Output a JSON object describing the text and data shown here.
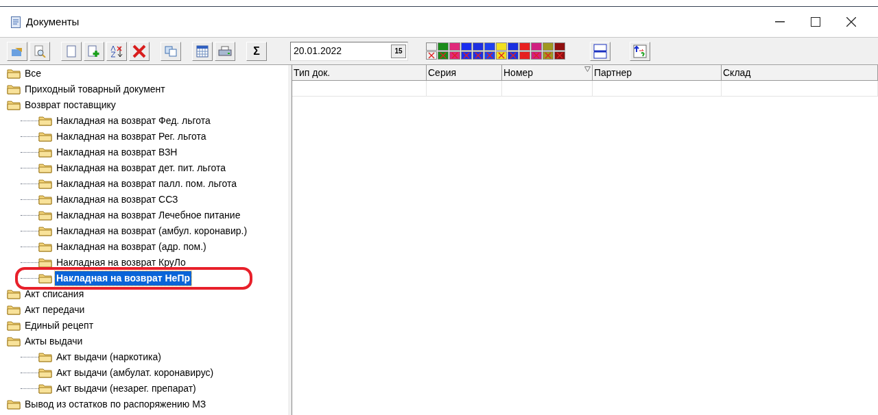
{
  "window": {
    "title": "Документы"
  },
  "filter": {
    "date": "20.01.2022",
    "calendar_label": "15"
  },
  "toolbar": {
    "sum_label": "Σ"
  },
  "tree": [
    {
      "label": "Все",
      "selected": false
    },
    {
      "label": "Приходный товарный документ",
      "selected": false
    },
    {
      "label": "Возврат поставщику",
      "selected": false,
      "children": [
        {
          "label": "Накладная на возврат Фед. льгота",
          "selected": false
        },
        {
          "label": "Накладная на возврат Рег. льгота",
          "selected": false
        },
        {
          "label": "Накладная на возврат ВЗН",
          "selected": false
        },
        {
          "label": "Накладная на возврат дет. пит. льгота",
          "selected": false
        },
        {
          "label": "Накладная на возврат палл. пом. льгота",
          "selected": false
        },
        {
          "label": "Накладная на возврат ССЗ",
          "selected": false
        },
        {
          "label": "Накладная на возврат Лечебное питание",
          "selected": false
        },
        {
          "label": "Накладная на возврат (амбул. коронавир.)",
          "selected": false
        },
        {
          "label": "Накладная на возврат (адр. пом.)",
          "selected": false
        },
        {
          "label": "Накладная на возврат КруЛо",
          "selected": false
        },
        {
          "label": "Накладная на возврат НеПр",
          "selected": true
        }
      ]
    },
    {
      "label": "Акт списания",
      "selected": false
    },
    {
      "label": "Акт передачи",
      "selected": false
    },
    {
      "label": "Единый рецепт",
      "selected": false
    },
    {
      "label": "Акты выдачи",
      "selected": false,
      "children": [
        {
          "label": "Акт выдачи (наркотика)",
          "selected": false
        },
        {
          "label": "Акт выдачи (амбулат. коронавирус)",
          "selected": false
        },
        {
          "label": "Акт выдачи (незарег. препарат)",
          "selected": false
        }
      ]
    },
    {
      "label": "Вывод из остатков по распоряжению МЗ",
      "selected": false
    }
  ],
  "table": {
    "columns": [
      {
        "label": "Тип док.",
        "sorted": false
      },
      {
        "label": "Серия",
        "sorted": false
      },
      {
        "label": "Номер",
        "sorted": true
      },
      {
        "label": "Партнер",
        "sorted": false
      },
      {
        "label": "Склад",
        "sorted": false
      }
    ]
  }
}
